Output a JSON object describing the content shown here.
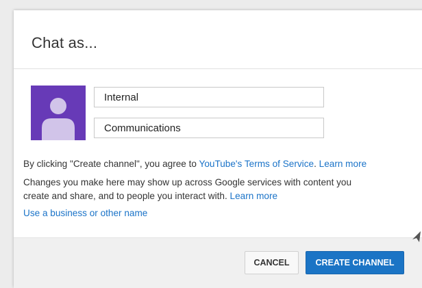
{
  "dialog": {
    "title": "Chat as...",
    "first_name_value": "Internal",
    "last_name_value": "Communications",
    "terms_prefix": "By clicking \"Create channel\", you agree to ",
    "terms_link": "YouTube's Terms of Service",
    "terms_sep": ". ",
    "terms_learn_more": "Learn more",
    "changes_line1": "Changes you make here may show up across Google services with content you",
    "changes_line2_prefix": "create and share, and to people you interact with. ",
    "changes_learn_more": "Learn more",
    "business_link": "Use a business or other name"
  },
  "buttons": {
    "cancel": "CANCEL",
    "create": "CREATE CHANNEL"
  },
  "colors": {
    "avatar_bg": "#673ab7",
    "avatar_figure": "#d1c4e9",
    "primary_button": "#1b74c5",
    "link": "#1a73c8"
  },
  "icons": {
    "avatar": "person-silhouette-icon",
    "cursor": "mouse-pointer-icon"
  }
}
